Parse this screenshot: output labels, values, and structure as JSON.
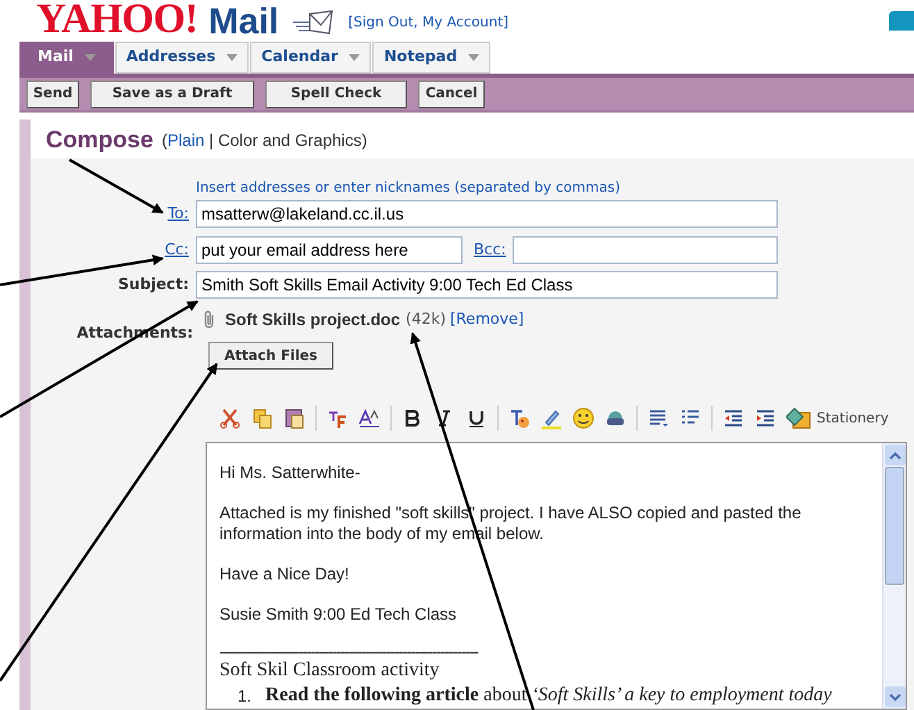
{
  "header": {
    "logo": "YAHOO!",
    "product": "Mail",
    "account_links": "[Sign Out, My Account]"
  },
  "tabs": [
    {
      "label": "Mail",
      "selected": true
    },
    {
      "label": "Addresses",
      "selected": false
    },
    {
      "label": "Calendar",
      "selected": false
    },
    {
      "label": "Notepad",
      "selected": false
    }
  ],
  "toolbar_buttons": [
    "Send",
    "Save as a Draft",
    "Spell Check",
    "Cancel"
  ],
  "compose": {
    "title": "Compose",
    "mode_open": "(",
    "modes": [
      {
        "label": "Plain",
        "selected": false
      },
      {
        "label": "Color and Graphics",
        "selected": true
      }
    ],
    "mode_sep": "|",
    "mode_close": ")"
  },
  "form": {
    "hint": "Insert addresses or enter nicknames (separated by commas)",
    "to": {
      "label": "To:",
      "value": "msatterw@lakeland.cc.il.us"
    },
    "cc": {
      "label": "Cc:",
      "value": "put your email address here"
    },
    "bcc": {
      "label": "Bcc:"
    },
    "subject": {
      "label": "Subject:",
      "value": "Smith Soft Skills Email Activity 9:00 Tech Ed Class"
    },
    "attachments_label": "Attachments:",
    "attachment": {
      "name": "Soft Skills project.doc",
      "size": "(42k)",
      "remove": "[Remove]"
    },
    "attach_button": "Attach Files"
  },
  "editor": {
    "stationery": "Stationery",
    "body": [
      {
        "kind": "para",
        "text": "Hi Ms. Satterwhite-"
      },
      {
        "kind": "para",
        "text": "Attached is my finished \"soft skills\" project.  I have ALSO copied and pasted the information into the body of my email below."
      },
      {
        "kind": "para",
        "text": "Have a Nice Day!"
      },
      {
        "kind": "para",
        "text": "Susie Smith 9:00 Ed Tech Class"
      },
      {
        "kind": "rule",
        "text": "--------------------------------------------------------------"
      },
      {
        "kind": "heading",
        "text": "Soft Skil Classroom activity"
      },
      {
        "kind": "item",
        "number": "1.",
        "text": "**Read the following article** about *‘Soft Skills’ a key to employment today*"
      }
    ]
  }
}
